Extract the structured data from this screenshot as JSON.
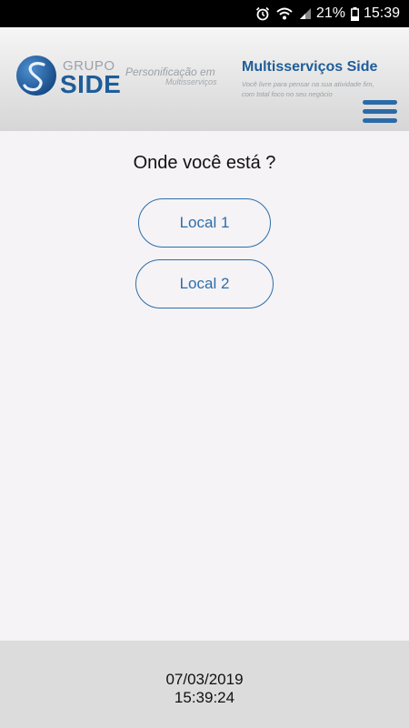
{
  "status_bar": {
    "battery_percent": "21%",
    "time": "15:39",
    "icons": [
      "alarm-icon",
      "wifi-icon",
      "signal-icon",
      "battery-icon"
    ]
  },
  "header": {
    "logo_top": "GRUPO",
    "logo_main": "SIDE",
    "tagline_line1": "Personificação em",
    "tagline_line2": "Multisserviços",
    "brand_title": "Multisserviços Side",
    "brand_subtitle": "Você livre para pensar na sua atividade fim, com total foco no seu negócio",
    "menu_icon": "hamburger-menu-icon"
  },
  "main": {
    "question": "Onde você está ?",
    "locations": [
      {
        "label": "Local 1"
      },
      {
        "label": "Local 2"
      }
    ]
  },
  "footer": {
    "date": "07/03/2019",
    "time": "15:39:24"
  },
  "colors": {
    "accent": "#2d6eab",
    "brand_blue": "#1f5d98",
    "background": "#f5f3f5",
    "footer_bg": "#dcdcdc"
  }
}
